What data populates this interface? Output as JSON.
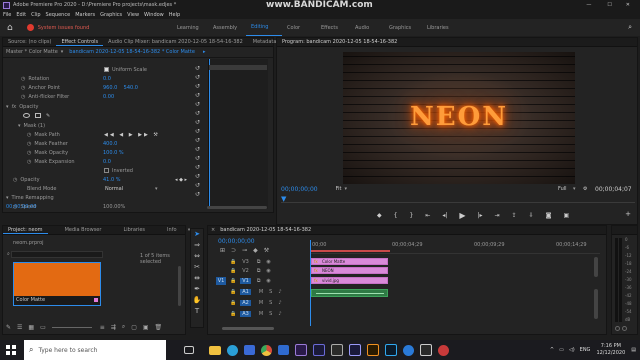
{
  "window": {
    "title": "Adobe Premiere Pro 2020 - D:\\Premiere Pro projects\\mask.edjes *",
    "controls": [
      "—",
      "☐",
      "✕"
    ]
  },
  "watermark": "www.BANDICAM.com",
  "menu": [
    "File",
    "Edit",
    "Clip",
    "Sequence",
    "Markers",
    "Graphics",
    "View",
    "Window",
    "Help"
  ],
  "workspaces": {
    "alert": "System issues found",
    "items": [
      "Learning",
      "Assembly",
      "Editing",
      "Color",
      "Effects",
      "Audio",
      "Graphics",
      "Libraries"
    ],
    "active": "Editing"
  },
  "source_tabs": [
    "Source: (no clips)",
    "Effect Controls",
    "Audio Clip Mixer: bandicam 2020-12-05 18-54-16-382",
    "Metadata"
  ],
  "effect_controls": {
    "master": "Master * Color Matte",
    "clip": "bandicam 2020-12-05 18-54-16-382 * Color Matte",
    "uniform_scale": "Uniform Scale",
    "rows": [
      {
        "label": "Rotation",
        "value": "0.0"
      },
      {
        "label": "Anchor Point",
        "value": "960.0    540.0"
      },
      {
        "label": "Anti-flicker Filter",
        "value": "0.00"
      }
    ],
    "opacity_header": "Opacity",
    "mask_name": "Mask (1)",
    "mask_rows": [
      {
        "label": "Mask Path",
        "value": ""
      },
      {
        "label": "Mask Feather",
        "value": "400.0"
      },
      {
        "label": "Mask Opacity",
        "value": "100.0 %"
      },
      {
        "label": "Mask Expansion",
        "value": "0.0"
      }
    ],
    "inverted": "Inverted",
    "opacity": {
      "label": "Opacity",
      "value": "41.0 %"
    },
    "blend_mode": {
      "label": "Blend Mode",
      "value": "Normal"
    },
    "time_remap": "Time Remapping",
    "speed": {
      "label": "Speed",
      "value": "100.00%"
    },
    "timecode": "00;00;00;00"
  },
  "program": {
    "title": "Program: bandicam 2020-12-05 18-54-16-382",
    "neon_text": "NEON",
    "timecode": "00;00;00;00",
    "fit": "Fit",
    "quality": "Full",
    "duration": "00;00;04;07"
  },
  "project": {
    "tabs": [
      "Project: neom",
      "Media Browser",
      "Libraries",
      "Info"
    ],
    "file": "neom.prproj",
    "selection": "1 of 5 items selected",
    "item_label": "Color Matte"
  },
  "timeline": {
    "title": "bandicam 2020-12-05 18-54-16-382",
    "timecode": "00;00;00;00",
    "ruler": [
      "00;00",
      "00;00;04;29",
      "00;00;09;29",
      "00;00;14;29"
    ],
    "video_tracks": [
      "V3",
      "V2",
      "V1"
    ],
    "audio_tracks": [
      "A1",
      "A2",
      "A3"
    ],
    "clips": [
      "Color Matte",
      "NEON",
      "vivid.jpg"
    ]
  },
  "meter_labels": [
    "0",
    "-6",
    "-12",
    "-18",
    "-24",
    "-30",
    "-36",
    "-42",
    "-48",
    "-54",
    "dB"
  ],
  "taskbar": {
    "search_placeholder": "Type here to search",
    "lang": "ENG",
    "time": "7:16 PM",
    "date": "12/12/2020"
  }
}
